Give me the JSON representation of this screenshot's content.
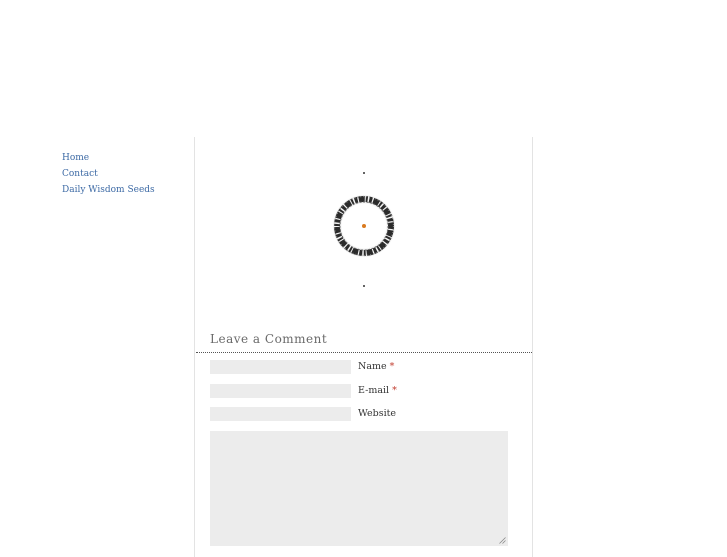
{
  "nav": {
    "items": [
      {
        "label": "Home"
      },
      {
        "label": "Contact"
      },
      {
        "label": "Daily Wisdom Seeds"
      }
    ]
  },
  "content": {
    "image_icon": "enso-circle-icon"
  },
  "comment_form": {
    "heading": "Leave a Comment",
    "name_label": "Name",
    "email_label": "E-mail",
    "website_label": "Website",
    "required_mark": "*",
    "name_value": "",
    "email_value": "",
    "website_value": "",
    "comment_value": ""
  },
  "colors": {
    "link": "#3d6aa5",
    "required": "#c0392b",
    "input_bg": "#ececec",
    "enso_center": "#d97a1f"
  }
}
